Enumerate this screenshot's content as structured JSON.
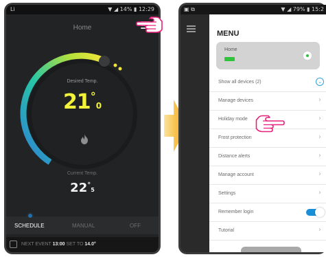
{
  "left_phone": {
    "status_left": "Li",
    "status_right": "▼ ◢ 14% ▮ 12:29",
    "title": "Home",
    "desired_label": "Desired Temp.",
    "desired_int": "21",
    "desired_deg": "°",
    "desired_dec": "0",
    "flame_icon": "🔥",
    "current_label": "Current Temp.",
    "current_int": "22",
    "current_deg": "°",
    "current_dec": "5",
    "modes": [
      "SCHEDULE",
      "MANUAL",
      "OFF"
    ],
    "next_event_label": "NEXT EVENT",
    "next_event_time": "13:00",
    "set_to_label": "SET TO",
    "set_to_value": "14.0°"
  },
  "right_phone": {
    "status_left": "▣ ⧉",
    "status_right": "▼ ◢ 79% ▮ 15:2",
    "menu_title": "MENU",
    "home_card_label": "Home",
    "menu_items": [
      "Show all devices (2)",
      "Manage devices",
      "Holiday mode",
      "Frost protection",
      "Distance alerts",
      "Manage account",
      "Settings",
      "Remember login",
      "Tutorial"
    ]
  },
  "colors": {
    "accent_pink": "#e91e7a",
    "arrow_orange": "#f5a623",
    "toggle_blue": "#1b8ed8",
    "desired_yellow": "#f2f23a"
  }
}
